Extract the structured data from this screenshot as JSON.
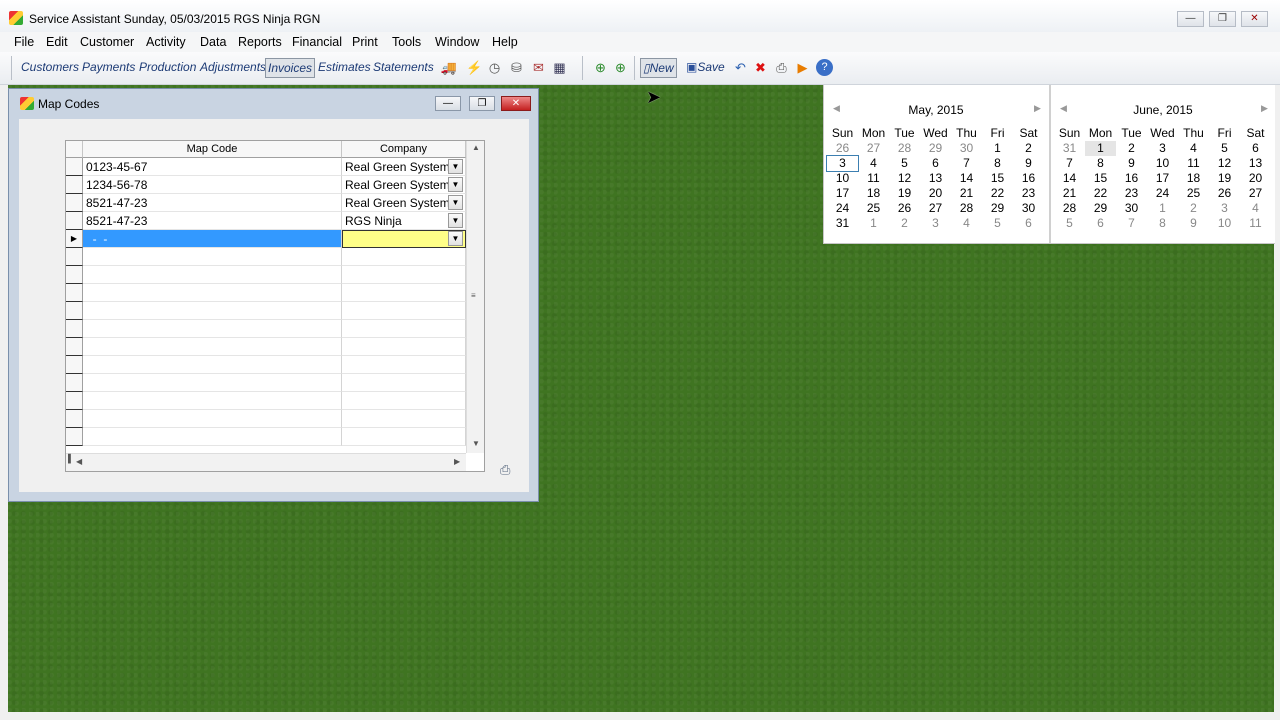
{
  "window": {
    "title": "Service Assistant  Sunday, 05/03/2015  RGS Ninja  RGN",
    "min": "—",
    "max": "❐",
    "close": "✕"
  },
  "menu": [
    "File",
    "Edit",
    "Customer",
    "Activity",
    "Data",
    "Reports",
    "Financial",
    "Print",
    "Tools",
    "Window",
    "Help"
  ],
  "toolbar": {
    "text_buttons": [
      "Customers",
      "Payments",
      "Production",
      "Adjustments",
      "Invoices",
      "Estimates",
      "Statements"
    ],
    "pressed": "Invoices",
    "new_label": "New",
    "save_label": "Save"
  },
  "calendars": [
    {
      "title": "May, 2015",
      "weekdays": [
        "Sun",
        "Mon",
        "Tue",
        "Wed",
        "Thu",
        "Fri",
        "Sat"
      ],
      "weeks": [
        [
          "26",
          "27",
          "28",
          "29",
          "30",
          "1",
          "2"
        ],
        [
          "3",
          "4",
          "5",
          "6",
          "7",
          "8",
          "9"
        ],
        [
          "10",
          "11",
          "12",
          "13",
          "14",
          "15",
          "16"
        ],
        [
          "17",
          "18",
          "19",
          "20",
          "21",
          "22",
          "23"
        ],
        [
          "24",
          "25",
          "26",
          "27",
          "28",
          "29",
          "30"
        ],
        [
          "31",
          "1",
          "2",
          "3",
          "4",
          "5",
          "6"
        ]
      ]
    },
    {
      "title": "June, 2015",
      "weekdays": [
        "Sun",
        "Mon",
        "Tue",
        "Wed",
        "Thu",
        "Fri",
        "Sat"
      ],
      "weeks": [
        [
          "31",
          "1",
          "2",
          "3",
          "4",
          "5",
          "6"
        ],
        [
          "7",
          "8",
          "9",
          "10",
          "11",
          "12",
          "13"
        ],
        [
          "14",
          "15",
          "16",
          "17",
          "18",
          "19",
          "20"
        ],
        [
          "21",
          "22",
          "23",
          "24",
          "25",
          "26",
          "27"
        ],
        [
          "28",
          "29",
          "30",
          "1",
          "2",
          "3",
          "4"
        ],
        [
          "5",
          "6",
          "7",
          "8",
          "9",
          "10",
          "11"
        ]
      ]
    }
  ],
  "map_codes": {
    "title": "Map Codes",
    "columns": [
      "Map Code",
      "Company"
    ],
    "rows": [
      [
        "0123-45-67",
        "Real Green System"
      ],
      [
        "1234-56-78",
        "Real Green System"
      ],
      [
        "8521-47-23",
        "Real Green System"
      ],
      [
        "8521-47-23",
        "RGS Ninja"
      ]
    ],
    "new_row_mask": "  -  -"
  }
}
